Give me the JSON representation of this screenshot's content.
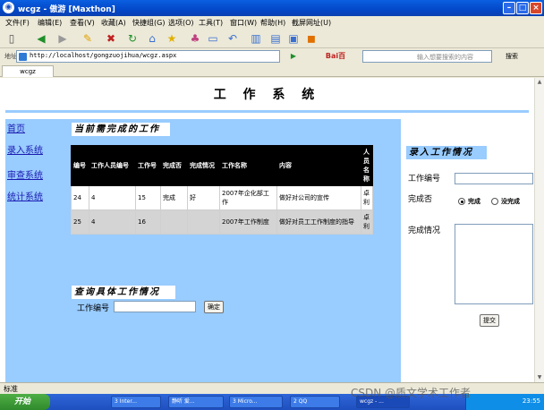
{
  "window": {
    "title": "wcgz - 傲游 [Maxthon]"
  },
  "menu": [
    "文件(F)",
    "编辑(E)",
    "查看(V)",
    "收藏(A)",
    "快捷组(G)",
    "选项(O)",
    "工具(T)",
    "窗口(W)",
    "帮助(H)",
    "截屏网址(U)"
  ],
  "address": {
    "label": "地址",
    "url": "http://localhost/gongzuojihua/wcgz.aspx"
  },
  "search": {
    "placeholder": "输入想要搜索的内容",
    "button": "搜索"
  },
  "tab": {
    "label": "wcgz"
  },
  "page": {
    "title": "工 作 系 统",
    "nav": [
      "首页",
      "录入系统",
      "审查系统",
      "统计系统"
    ],
    "current_section": "当前需完成的工作",
    "table": {
      "headers": [
        "编号",
        "工作人员编号",
        "工作号",
        "完成否",
        "完成情况",
        "工作名称",
        "内容",
        "人员名称"
      ],
      "rows": [
        [
          "24",
          "4",
          "15",
          "完成",
          "好",
          "2007年企化部工作",
          "做好对公司的宣传",
          "卓利"
        ],
        [
          "25",
          "4",
          "16",
          "",
          "",
          "2007年工作制度",
          "做好对员工工作制度的指导",
          "卓利"
        ]
      ]
    },
    "query_section": "查询具体工作情况",
    "query_label": "工作编号",
    "query_button": "确定",
    "entry_section": "录入工作情况",
    "entry_id_label": "工作编号",
    "entry_done_label": "完成否",
    "radio_done": "完成",
    "radio_notdone": "没完成",
    "entry_status_label": "完成情况",
    "submit_button": "提交"
  },
  "status": {
    "left": "标准"
  },
  "taskbar": {
    "start": "开始",
    "items": [
      "3 Inter...",
      "静听 爱...",
      "3 Micro...",
      "2 QQ",
      "wcgz - ..."
    ],
    "clock": "23:55"
  },
  "watermark": "CSDN @质文学术工作者"
}
